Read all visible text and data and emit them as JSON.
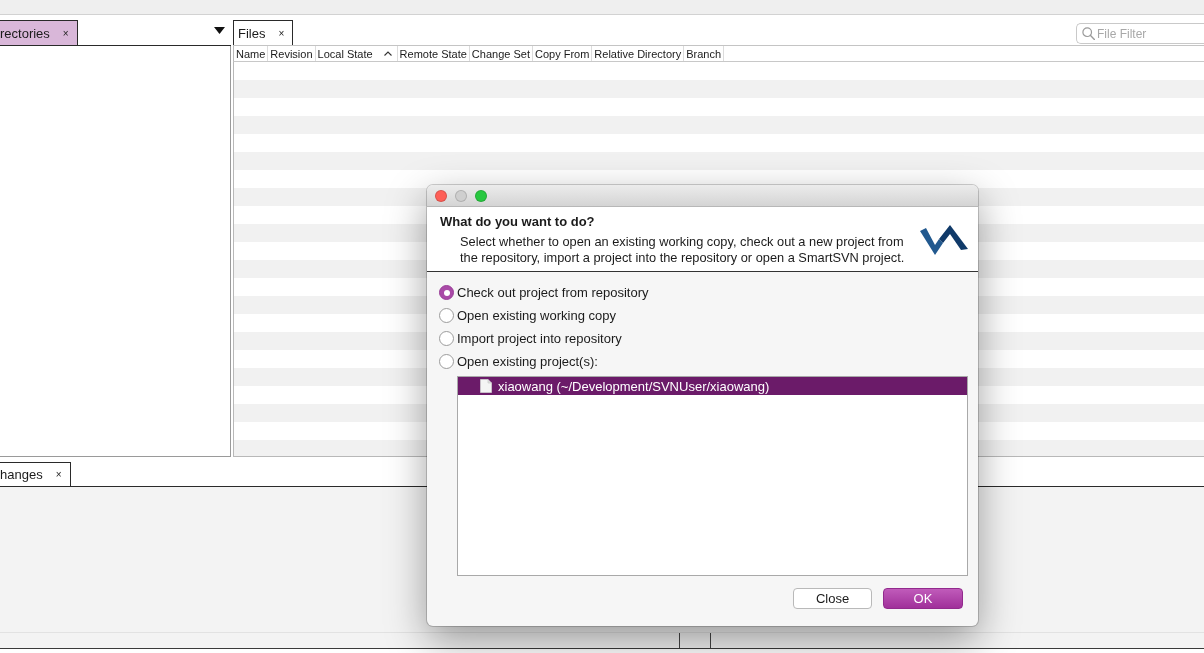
{
  "left_panel": {
    "tab": {
      "label": "rectories",
      "close": "×",
      "selected": true
    }
  },
  "files_panel": {
    "tab": {
      "label": "Files",
      "close": "×",
      "selected": false
    },
    "filter": {
      "placeholder": "File Filter"
    },
    "table": {
      "columns": [
        {
          "label": "Name",
          "sorted": false
        },
        {
          "label": "Revision",
          "sorted": false
        },
        {
          "label": "Local State",
          "sorted": true
        },
        {
          "label": "Remote State",
          "sorted": false
        },
        {
          "label": "Change Set",
          "sorted": false
        },
        {
          "label": "Copy From",
          "sorted": false
        },
        {
          "label": "Relative Directory",
          "sorted": false
        },
        {
          "label": "Branch",
          "sorted": false
        }
      ]
    }
  },
  "changes_panel": {
    "tab": {
      "label": "hanges",
      "close": "×",
      "selected": false
    }
  },
  "dialog": {
    "window_controls": [
      {
        "kind": "close",
        "enabled": true
      },
      {
        "kind": "minimize",
        "enabled": false
      },
      {
        "kind": "zoom",
        "enabled": true
      }
    ],
    "heading": "What do you want to do?",
    "description": "Select whether to open an existing working copy, check out a new project from the repository, import a project into the repository or open a SmartSVN project.",
    "options": [
      {
        "label": "Check out project from repository",
        "selected": true
      },
      {
        "label": "Open existing working copy",
        "selected": false
      },
      {
        "label": "Import project into repository",
        "selected": false
      },
      {
        "label": "Open existing project(s):",
        "selected": false
      }
    ],
    "projects": [
      {
        "label": "xiaowang (~/Development/SVNUser/xiaowang)",
        "selected": true
      }
    ],
    "buttons": [
      {
        "label": "Close",
        "kind": "secondary"
      },
      {
        "label": "OK",
        "kind": "primary"
      }
    ]
  }
}
